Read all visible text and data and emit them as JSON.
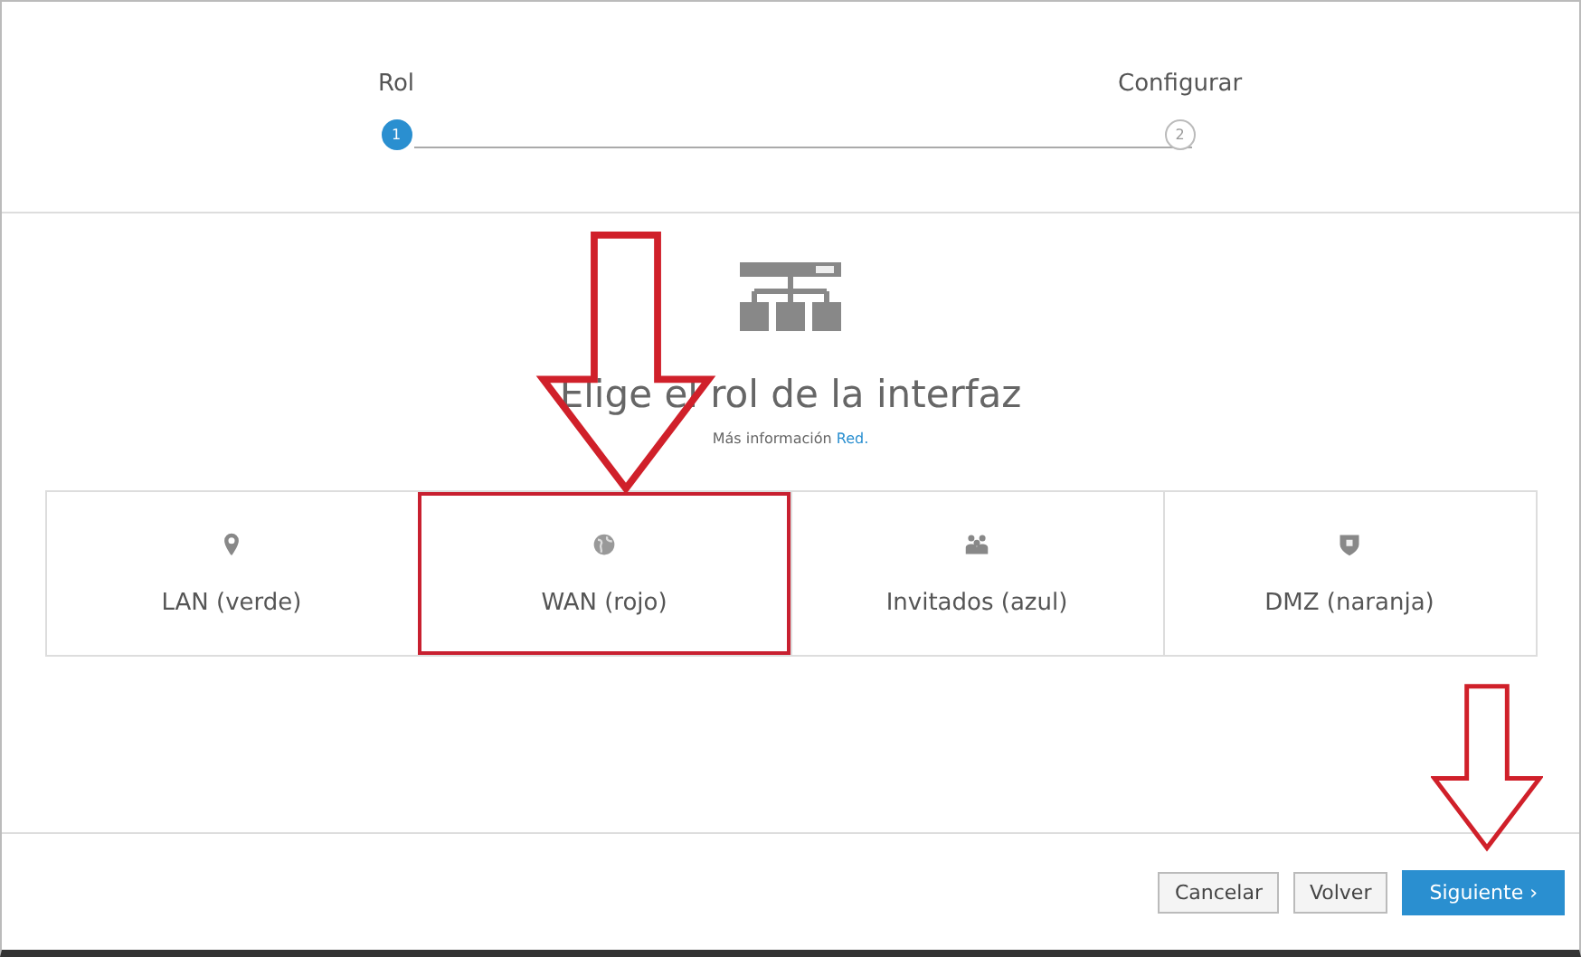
{
  "steps": [
    {
      "label": "Rol",
      "number": "1",
      "selected": true
    },
    {
      "label": "Configurar",
      "number": "2",
      "selected": false
    }
  ],
  "heading": "Elige el rol de la interfaz",
  "more_info": {
    "text": "Más información",
    "link": "Red."
  },
  "roles": [
    {
      "label": "LAN (verde)",
      "kind": "pin",
      "selected": false
    },
    {
      "label": "WAN (rojo)",
      "kind": "globe",
      "selected": true
    },
    {
      "label": "Invitados (azul)",
      "kind": "people",
      "selected": false
    },
    {
      "label": "DMZ (naranja)",
      "kind": "shield",
      "selected": false
    }
  ],
  "buttons": [
    {
      "label": "Cancelar",
      "kind": "secondary"
    },
    {
      "label": "Volver",
      "kind": "secondary"
    },
    {
      "label": "Siguiente ›",
      "kind": "primary"
    }
  ],
  "callout_arrows": [
    {
      "kind": "outline-arrow"
    },
    {
      "kind": "outline-arrow"
    }
  ]
}
